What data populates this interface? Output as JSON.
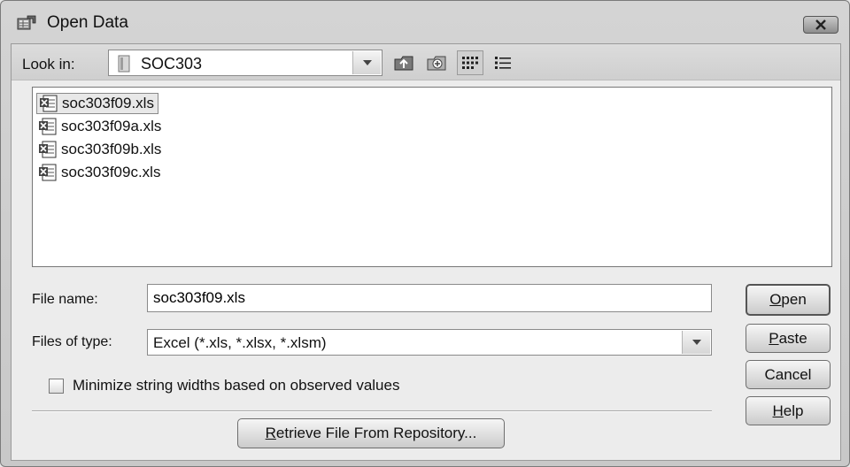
{
  "window": {
    "title": "Open Data",
    "close_icon": "close-x-icon"
  },
  "lookin": {
    "label": "Look in:",
    "value": "SOC303",
    "folder_icon": "folder-icon",
    "tools": [
      "up-folder-icon",
      "new-folder-icon",
      "list-view-icon",
      "details-view-icon"
    ]
  },
  "files": [
    {
      "name": "soc303f09.xls",
      "selected": true
    },
    {
      "name": "soc303f09a.xls",
      "selected": false
    },
    {
      "name": "soc303f09b.xls",
      "selected": false
    },
    {
      "name": "soc303f09c.xls",
      "selected": false
    }
  ],
  "filename": {
    "label": "File name:",
    "value": "soc303f09.xls"
  },
  "filetype": {
    "label": "Files of type:",
    "value": "Excel (*.xls, *.xlsx, *.xlsm)"
  },
  "options": {
    "minimize_label": "Minimize string widths based on observed values",
    "minimize_checked": false
  },
  "buttons": {
    "open": {
      "first": "O",
      "rest": "pen"
    },
    "paste": {
      "first": "P",
      "rest": "aste"
    },
    "cancel": "Cancel",
    "help": {
      "first": "H",
      "rest": "elp"
    },
    "retrieve": {
      "first": "R",
      "rest": "etrieve File From Repository..."
    }
  }
}
